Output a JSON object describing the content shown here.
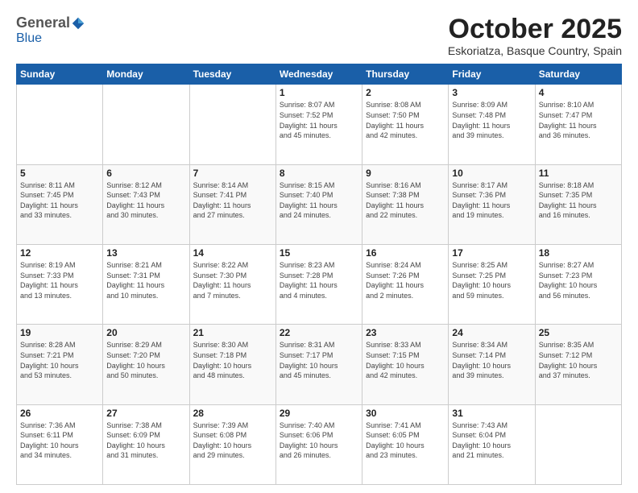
{
  "logo": {
    "general": "General",
    "blue": "Blue"
  },
  "header": {
    "month": "October 2025",
    "location": "Eskoriatza, Basque Country, Spain"
  },
  "weekdays": [
    "Sunday",
    "Monday",
    "Tuesday",
    "Wednesday",
    "Thursday",
    "Friday",
    "Saturday"
  ],
  "weeks": [
    [
      {
        "day": "",
        "info": ""
      },
      {
        "day": "",
        "info": ""
      },
      {
        "day": "",
        "info": ""
      },
      {
        "day": "1",
        "info": "Sunrise: 8:07 AM\nSunset: 7:52 PM\nDaylight: 11 hours\nand 45 minutes."
      },
      {
        "day": "2",
        "info": "Sunrise: 8:08 AM\nSunset: 7:50 PM\nDaylight: 11 hours\nand 42 minutes."
      },
      {
        "day": "3",
        "info": "Sunrise: 8:09 AM\nSunset: 7:48 PM\nDaylight: 11 hours\nand 39 minutes."
      },
      {
        "day": "4",
        "info": "Sunrise: 8:10 AM\nSunset: 7:47 PM\nDaylight: 11 hours\nand 36 minutes."
      }
    ],
    [
      {
        "day": "5",
        "info": "Sunrise: 8:11 AM\nSunset: 7:45 PM\nDaylight: 11 hours\nand 33 minutes."
      },
      {
        "day": "6",
        "info": "Sunrise: 8:12 AM\nSunset: 7:43 PM\nDaylight: 11 hours\nand 30 minutes."
      },
      {
        "day": "7",
        "info": "Sunrise: 8:14 AM\nSunset: 7:41 PM\nDaylight: 11 hours\nand 27 minutes."
      },
      {
        "day": "8",
        "info": "Sunrise: 8:15 AM\nSunset: 7:40 PM\nDaylight: 11 hours\nand 24 minutes."
      },
      {
        "day": "9",
        "info": "Sunrise: 8:16 AM\nSunset: 7:38 PM\nDaylight: 11 hours\nand 22 minutes."
      },
      {
        "day": "10",
        "info": "Sunrise: 8:17 AM\nSunset: 7:36 PM\nDaylight: 11 hours\nand 19 minutes."
      },
      {
        "day": "11",
        "info": "Sunrise: 8:18 AM\nSunset: 7:35 PM\nDaylight: 11 hours\nand 16 minutes."
      }
    ],
    [
      {
        "day": "12",
        "info": "Sunrise: 8:19 AM\nSunset: 7:33 PM\nDaylight: 11 hours\nand 13 minutes."
      },
      {
        "day": "13",
        "info": "Sunrise: 8:21 AM\nSunset: 7:31 PM\nDaylight: 11 hours\nand 10 minutes."
      },
      {
        "day": "14",
        "info": "Sunrise: 8:22 AM\nSunset: 7:30 PM\nDaylight: 11 hours\nand 7 minutes."
      },
      {
        "day": "15",
        "info": "Sunrise: 8:23 AM\nSunset: 7:28 PM\nDaylight: 11 hours\nand 4 minutes."
      },
      {
        "day": "16",
        "info": "Sunrise: 8:24 AM\nSunset: 7:26 PM\nDaylight: 11 hours\nand 2 minutes."
      },
      {
        "day": "17",
        "info": "Sunrise: 8:25 AM\nSunset: 7:25 PM\nDaylight: 10 hours\nand 59 minutes."
      },
      {
        "day": "18",
        "info": "Sunrise: 8:27 AM\nSunset: 7:23 PM\nDaylight: 10 hours\nand 56 minutes."
      }
    ],
    [
      {
        "day": "19",
        "info": "Sunrise: 8:28 AM\nSunset: 7:21 PM\nDaylight: 10 hours\nand 53 minutes."
      },
      {
        "day": "20",
        "info": "Sunrise: 8:29 AM\nSunset: 7:20 PM\nDaylight: 10 hours\nand 50 minutes."
      },
      {
        "day": "21",
        "info": "Sunrise: 8:30 AM\nSunset: 7:18 PM\nDaylight: 10 hours\nand 48 minutes."
      },
      {
        "day": "22",
        "info": "Sunrise: 8:31 AM\nSunset: 7:17 PM\nDaylight: 10 hours\nand 45 minutes."
      },
      {
        "day": "23",
        "info": "Sunrise: 8:33 AM\nSunset: 7:15 PM\nDaylight: 10 hours\nand 42 minutes."
      },
      {
        "day": "24",
        "info": "Sunrise: 8:34 AM\nSunset: 7:14 PM\nDaylight: 10 hours\nand 39 minutes."
      },
      {
        "day": "25",
        "info": "Sunrise: 8:35 AM\nSunset: 7:12 PM\nDaylight: 10 hours\nand 37 minutes."
      }
    ],
    [
      {
        "day": "26",
        "info": "Sunrise: 7:36 AM\nSunset: 6:11 PM\nDaylight: 10 hours\nand 34 minutes."
      },
      {
        "day": "27",
        "info": "Sunrise: 7:38 AM\nSunset: 6:09 PM\nDaylight: 10 hours\nand 31 minutes."
      },
      {
        "day": "28",
        "info": "Sunrise: 7:39 AM\nSunset: 6:08 PM\nDaylight: 10 hours\nand 29 minutes."
      },
      {
        "day": "29",
        "info": "Sunrise: 7:40 AM\nSunset: 6:06 PM\nDaylight: 10 hours\nand 26 minutes."
      },
      {
        "day": "30",
        "info": "Sunrise: 7:41 AM\nSunset: 6:05 PM\nDaylight: 10 hours\nand 23 minutes."
      },
      {
        "day": "31",
        "info": "Sunrise: 7:43 AM\nSunset: 6:04 PM\nDaylight: 10 hours\nand 21 minutes."
      },
      {
        "day": "",
        "info": ""
      }
    ]
  ]
}
